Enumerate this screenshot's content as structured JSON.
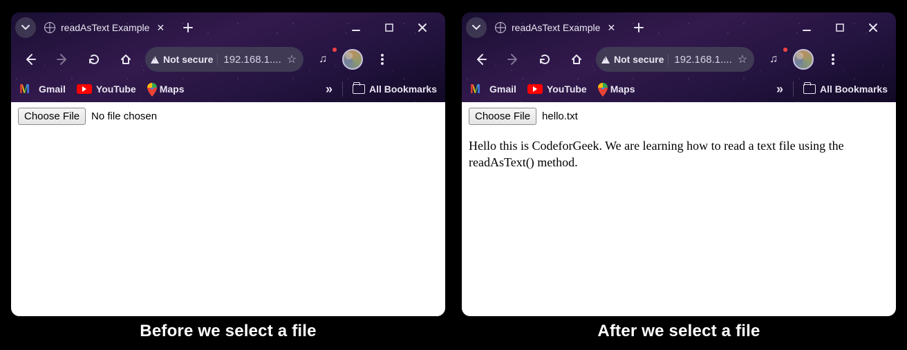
{
  "captions": {
    "before": "Before we select a file",
    "after": "After we select a file"
  },
  "tab": {
    "title": "readAsText Example"
  },
  "address": {
    "not_secure_label": "Not secure",
    "url_display": "192.168.1...."
  },
  "bookmarks": {
    "gmail": "Gmail",
    "youtube": "YouTube",
    "maps": "Maps",
    "all_bookmarks": "All Bookmarks"
  },
  "before": {
    "choose_label": "Choose File",
    "file_status": "No file chosen"
  },
  "after": {
    "choose_label": "Choose File",
    "file_status": "hello.txt",
    "body_text": "Hello this is CodeforGeek. We are learning how to read a text file using the readAsText() method."
  }
}
